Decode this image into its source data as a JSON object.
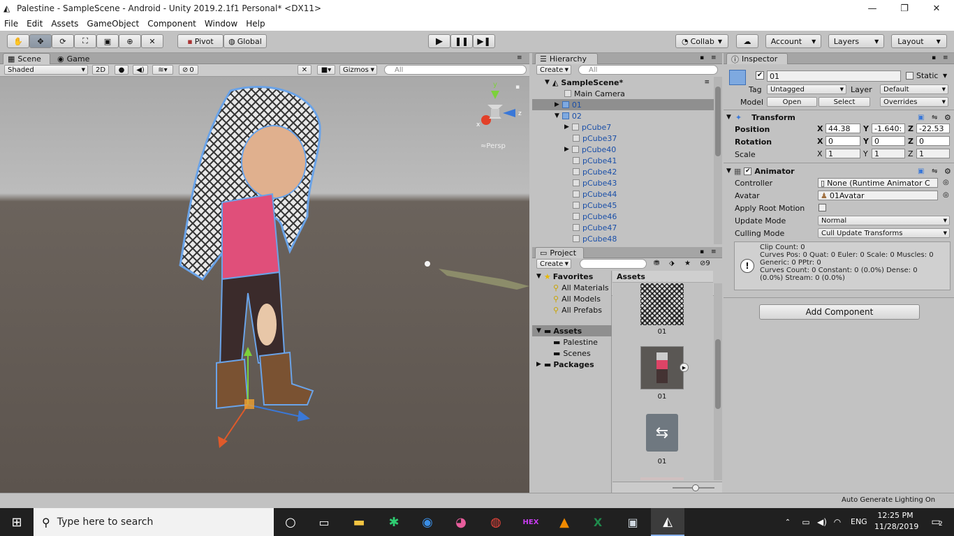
{
  "window": {
    "title": "Palestine - SampleScene - Android - Unity 2019.2.1f1 Personal* <DX11>",
    "minimize": "—",
    "maximize": "❐",
    "close": "✕"
  },
  "menu": [
    "File",
    "Edit",
    "Assets",
    "GameObject",
    "Component",
    "Window",
    "Help"
  ],
  "toolbar": {
    "pivot": "Pivot",
    "global": "Global",
    "collab": "Collab",
    "account": "Account",
    "layers": "Layers",
    "layout": "Layout"
  },
  "scene": {
    "tab_scene": "Scene",
    "tab_game": "Game",
    "shading": "Shaded",
    "mode_2d": "2D",
    "hidden_count": "0",
    "gizmos": "Gizmos",
    "search_placeholder": "All",
    "persp_label": "Persp",
    "axis_y": "y",
    "axis_x": "x",
    "axis_z": "z"
  },
  "hierarchy": {
    "tab": "Hierarchy",
    "create": "Create",
    "search_placeholder": "All",
    "scene_name": "SampleScene*",
    "items": [
      {
        "label": "Main Camera"
      },
      {
        "label": "01"
      },
      {
        "label": "02"
      },
      {
        "label": "pCube7"
      },
      {
        "label": "pCube37"
      },
      {
        "label": "pCube40"
      },
      {
        "label": "pCube41"
      },
      {
        "label": "pCube42"
      },
      {
        "label": "pCube43"
      },
      {
        "label": "pCube44"
      },
      {
        "label": "pCube45"
      },
      {
        "label": "pCube46"
      },
      {
        "label": "pCube47"
      },
      {
        "label": "pCube48"
      }
    ]
  },
  "project": {
    "tab": "Project",
    "create": "Create",
    "filter_count": "9",
    "favorites": "Favorites",
    "fav_items": [
      "All Materials",
      "All Models",
      "All Prefabs"
    ],
    "assets_root": "Assets",
    "asset_folders": [
      "Palestine",
      "Scenes"
    ],
    "packages": "Packages",
    "assets_header": "Assets",
    "asset_items": [
      {
        "label": "01"
      },
      {
        "label": "01"
      },
      {
        "label": "01"
      }
    ]
  },
  "inspector": {
    "tab": "Inspector",
    "object_name": "01",
    "static_label": "Static",
    "tag_label": "Tag",
    "tag_value": "Untagged",
    "layer_label": "Layer",
    "layer_value": "Default",
    "model_label": "Model",
    "open": "Open",
    "select": "Select",
    "overrides": "Overrides",
    "transform": {
      "title": "Transform",
      "position_label": "Position",
      "rotation_label": "Rotation",
      "scale_label": "Scale",
      "position": {
        "x": "44.38",
        "y": "-1.640:",
        "z": "-22.53"
      },
      "rotation": {
        "x": "0",
        "y": "0",
        "z": "0"
      },
      "scale": {
        "x": "1",
        "y": "1",
        "z": "1"
      },
      "axis_x": "X",
      "axis_y": "Y",
      "axis_z": "Z"
    },
    "animator": {
      "title": "Animator",
      "controller_label": "Controller",
      "controller_value": "None (Runtime Animator C",
      "avatar_label": "Avatar",
      "avatar_value": "01Avatar",
      "apply_root_motion_label": "Apply Root Motion",
      "update_mode_label": "Update Mode",
      "update_mode_value": "Normal",
      "culling_mode_label": "Culling Mode",
      "culling_mode_value": "Cull Update Transforms",
      "info_lines": [
        "Clip Count: 0",
        "Curves Pos: 0 Quat: 0 Euler: 0 Scale: 0 Muscles: 0",
        "Generic: 0 PPtr: 0",
        "Curves Count: 0 Constant: 0 (0.0%) Dense: 0",
        "(0.0%) Stream: 0 (0.0%)"
      ]
    },
    "add_component": "Add Component"
  },
  "statusbar": {
    "right": "Auto Generate Lighting On"
  },
  "taskbar": {
    "search_placeholder": "Type here to search",
    "language": "ENG",
    "time": "12:25 PM",
    "date": "11/28/2019",
    "notifications": "2"
  },
  "colors": {
    "sky": "#b6b6b6",
    "ground": "#5e5650",
    "selection_outline": "#6aa3e8",
    "taskbar": "#202020"
  }
}
